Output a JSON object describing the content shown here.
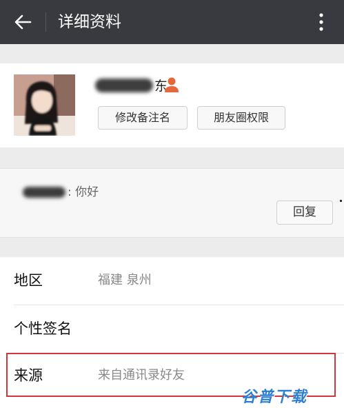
{
  "header": {
    "title": "详细资料",
    "back_icon": "arrow-left-icon",
    "more_icon": "more-vertical-icon"
  },
  "profile": {
    "name_suffix": "东",
    "gender_icon": "person-icon",
    "gender_color": "#e8663c",
    "buttons": {
      "remark_label": "修改备注名",
      "moments_label": "朋友圈权限"
    }
  },
  "message": {
    "text": ": 你好",
    "reply_label": "回复"
  },
  "details": [
    {
      "label": "地区",
      "value": "福建  泉州"
    },
    {
      "label": "个性签名",
      "value": ""
    },
    {
      "label": "来源",
      "value": "来自通讯录好友"
    }
  ],
  "watermark": "谷普下载",
  "colors": {
    "topbar": "#393a3f",
    "highlight_border": "#d8333a",
    "watermark": "#2d7fd4"
  }
}
